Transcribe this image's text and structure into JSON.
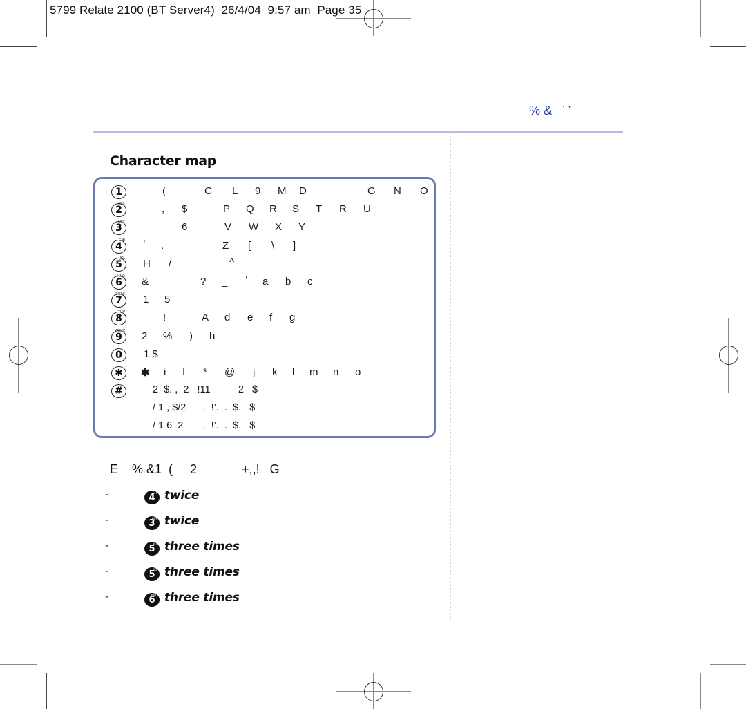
{
  "slug": {
    "text": "5799 Relate 2100 (BT Server4)  26/4/04  9:57 am  Page 35"
  },
  "running_head": {
    "text": "% &   ’ ’",
    "color": "#2b3f9c"
  },
  "section": {
    "title": "Character map",
    "box_color": "#6e79ad"
  },
  "character_map": {
    "keys": [
      {
        "key": "1",
        "letters": "",
        "cells": [
          "(",
          "C",
          "L",
          "9",
          "M",
          "D",
          "G",
          "N",
          "O"
        ]
      },
      {
        "key": "2",
        "letters": "ABC",
        "cells": [
          ",",
          "$",
          "P",
          "Q",
          "R",
          "S",
          "T",
          "R",
          "U"
        ]
      },
      {
        "key": "3",
        "letters": "DEF",
        "cells": [
          "6",
          "V",
          "W",
          "X",
          "Y"
        ]
      },
      {
        "key": "4",
        "letters": "GHI",
        "cells": [
          "’",
          ".",
          "Z",
          "[",
          "\\",
          "]"
        ]
      },
      {
        "key": "5",
        "letters": "JKL",
        "cells": [
          "H",
          "/",
          "^"
        ]
      },
      {
        "key": "6",
        "letters": "MNO",
        "cells": [
          "&",
          "?",
          "_",
          "‘",
          "a",
          "b",
          "c"
        ]
      },
      {
        "key": "7",
        "letters": "PQRS",
        "cells": [
          "1",
          "5"
        ]
      },
      {
        "key": "8",
        "letters": "TUV",
        "cells": [
          "!",
          "A",
          "d",
          "e",
          "f",
          "g"
        ]
      },
      {
        "key": "9",
        "letters": "WXYZ",
        "cells": [
          "2",
          "%",
          ")",
          "h"
        ]
      },
      {
        "key": "0",
        "letters": "",
        "cells": [
          "1 $"
        ]
      },
      {
        "key": "✱",
        "letters": "",
        "cells": [
          "✱",
          "i",
          "I",
          "*",
          "@",
          "j",
          "k",
          "l",
          "m",
          "n",
          "o"
        ]
      },
      {
        "key": "#",
        "letters": "",
        "lines": [
          "2  $. ,  2   !11          2   $",
          "/ 1 , $/2      .  !’.  .  $.   $",
          "/ 1 6  2       .  !’.  .  $.   $"
        ]
      }
    ]
  },
  "example": {
    "intro": "E    % &1  (     2             +,,!   G",
    "steps": [
      {
        "dash": "-",
        "key": "4",
        "letters": "GHI",
        "instruction": "twice"
      },
      {
        "dash": "-",
        "key": "3",
        "letters": "DEF",
        "instruction": "twice"
      },
      {
        "dash": "-",
        "key": "5",
        "letters": "JKL",
        "instruction": "three times"
      },
      {
        "dash": "-",
        "key": "5",
        "letters": "JKL",
        "instruction": "three times"
      },
      {
        "dash": "-",
        "key": "6",
        "letters": "MNO",
        "instruction": "three times"
      }
    ]
  }
}
